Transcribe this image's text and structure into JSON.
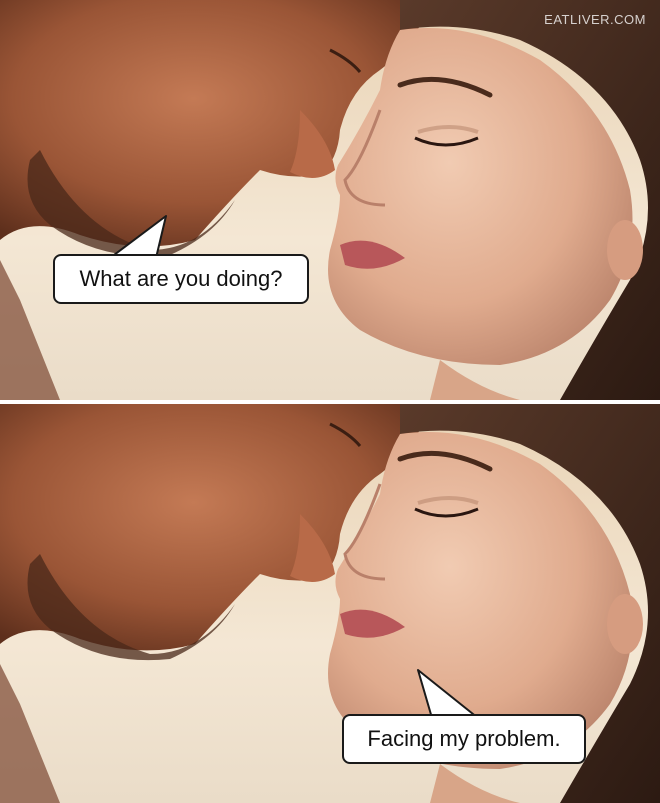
{
  "watermark": "EATLIVER.COM",
  "panels": [
    {
      "speaker": "man",
      "caption": "What are you doing?"
    },
    {
      "speaker": "woman",
      "caption": "Facing my problem."
    }
  ],
  "colors": {
    "bubble_fill": "#ffffff",
    "bubble_border": "#1a1a1a",
    "text": "#111111",
    "divider": "#ffffff"
  }
}
